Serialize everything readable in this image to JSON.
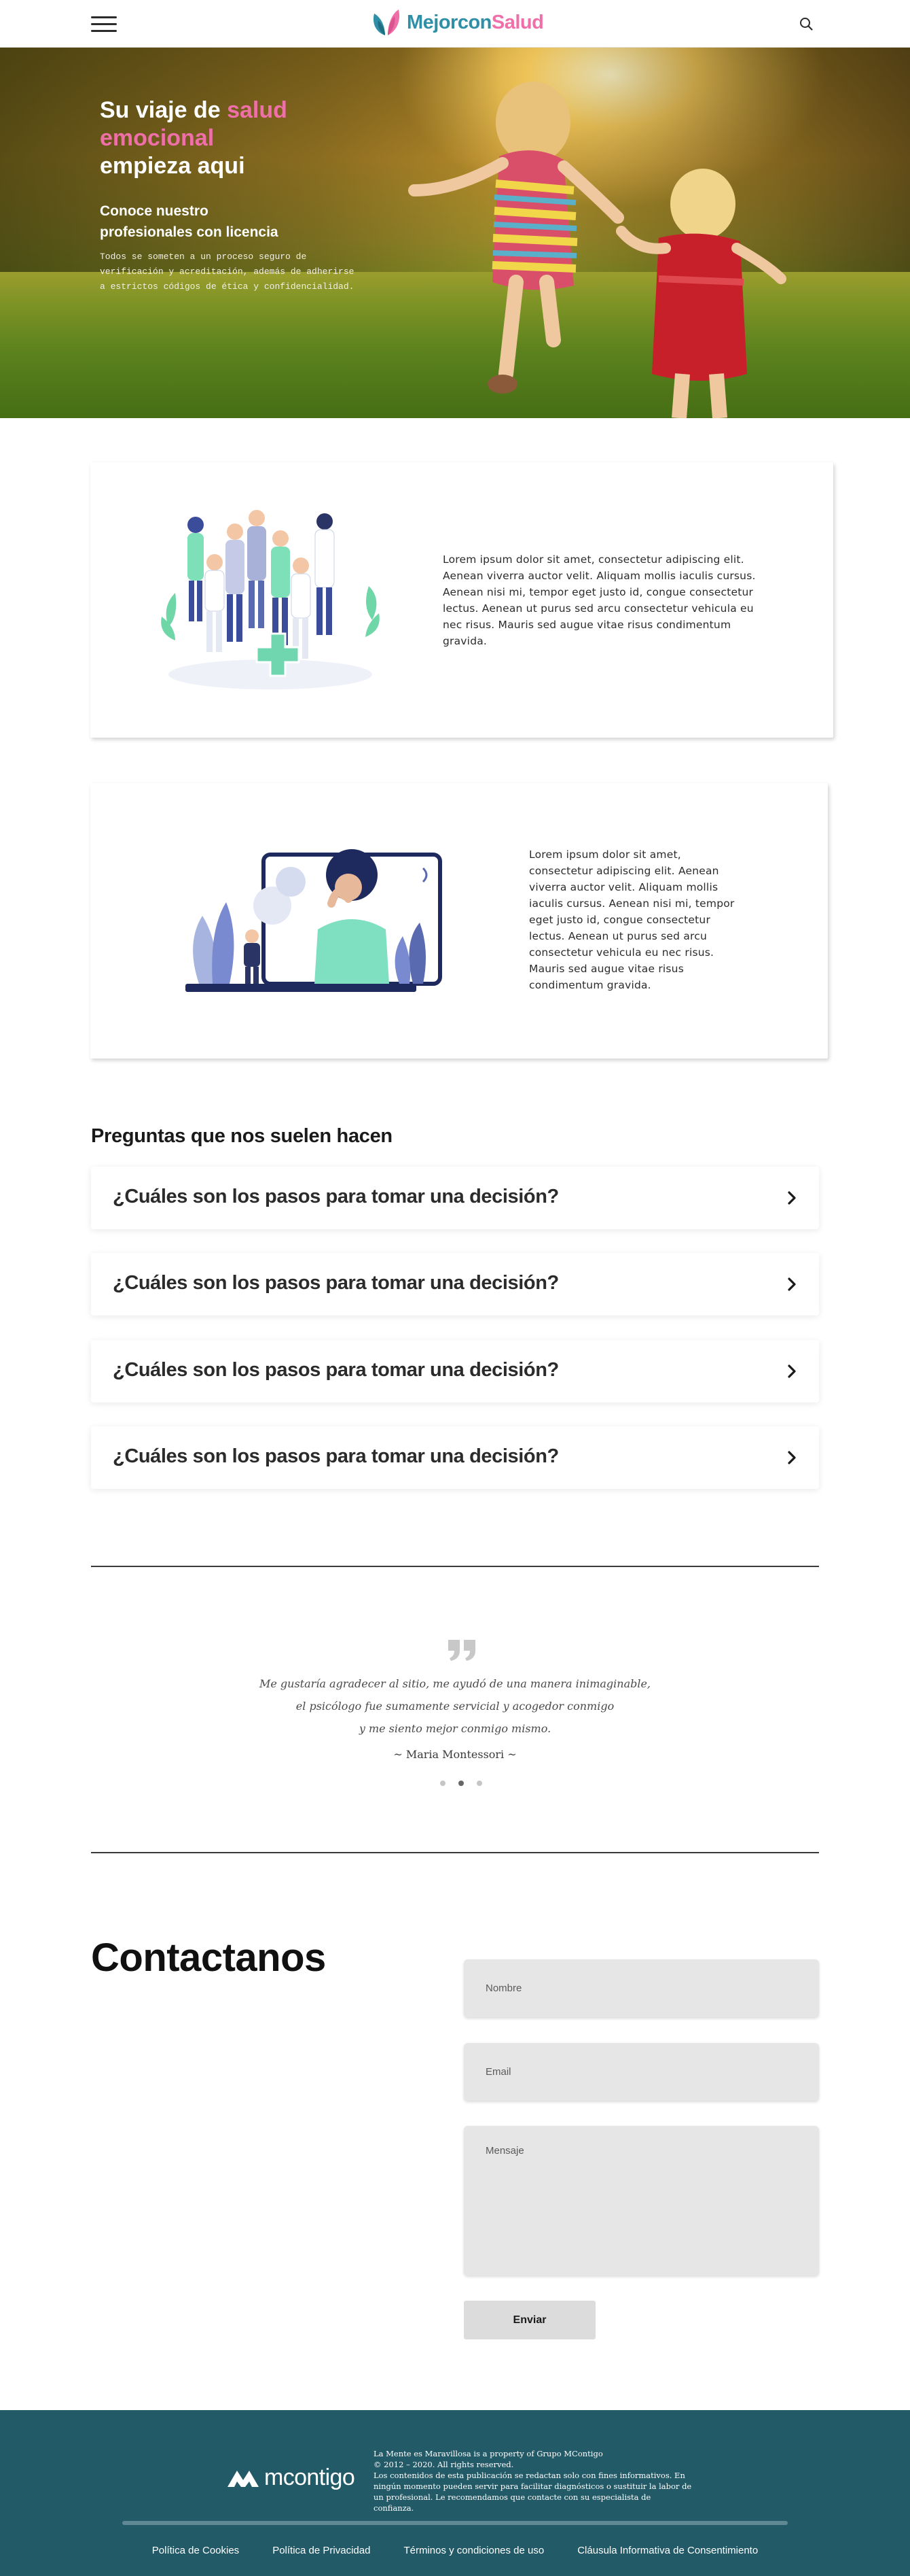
{
  "header": {
    "menu_icon": "hamburger-menu-icon",
    "logo_icon": "butterfly-icon",
    "logo_part1": "Mejor",
    "logo_part2": "con",
    "logo_part3": "Salud",
    "search_icon": "search-icon",
    "brand_colors": {
      "teal": "#2f8fa6",
      "pink": "#ef6fa8"
    }
  },
  "hero": {
    "title_prefix": "Su viaje de ",
    "title_highlight_1": "salud",
    "title_highlight_2": "emocional",
    "title_suffix": "empieza aqui",
    "subtitle_line1": "Conoce nuestro",
    "subtitle_line2": "profesionales con licencia",
    "description": "Todos se someten a un proceso seguro de verificación y acreditación, además de adherirse a estrictos códigos de ética y confidencialidad."
  },
  "features": [
    {
      "illustration": "medical-team-illustration",
      "text": "Lorem ipsum dolor sit amet, consectetur adipiscing elit. Aenean viverra auctor velit. Aliquam mollis iaculis cursus. Aenean nisi mi, tempor eget justo id, congue consectetur lectus. Aenean ut purus sed arcu consectetur vehicula eu nec risus.        Mauris sed augue vitae risus condimentum gravida."
    },
    {
      "illustration": "video-consultation-illustration",
      "text": "Lorem ipsum dolor sit amet, consectetur adipiscing elit. Aenean viverra auctor velit. Aliquam mollis iaculis cursus. Aenean nisi mi, tempor eget justo id, congue consectetur  lectus. Aenean ut purus sed arcu consectetur vehicula eu nec risus.        Mauris sed augue vitae risus condimentum gravida."
    }
  ],
  "faq": {
    "title": "Preguntas que nos suelen hacen",
    "items": [
      {
        "question": "¿Cuáles son los pasos para tomar una decisión?"
      },
      {
        "question": "¿Cuáles son los pasos para tomar una decisión?"
      },
      {
        "question": "¿Cuáles son los pasos para tomar una decisión?"
      },
      {
        "question": "¿Cuáles son los pasos para tomar una decisión?"
      }
    ]
  },
  "testimonial": {
    "quote_icon": "quote-icon",
    "line1": "Me gustaría agradecer al sitio, me ayudó de una manera inimaginable,",
    "line2": "el psicólogo fue sumamente servicial y acogedor conmigo",
    "line3": "y me siento mejor conmigo mismo.",
    "author": "~ Maria Montessori ~",
    "slide_count": 3,
    "active_slide": 2
  },
  "contact": {
    "title": "Contactanos",
    "name_placeholder": "Nombre",
    "email_placeholder": "Email",
    "message_placeholder": "Mensaje",
    "submit_label": "Enviar"
  },
  "footer": {
    "logo_text": "mcontigo",
    "logo_icon": "mcontigo-logo-icon",
    "info_line1": "La Mente es Maravillosa is a property of Grupo MContigo",
    "info_line2": "© 2012 – 2020. All rights reserved.",
    "info_line3": "Los contenidos de esta publicación se redactan solo con fines informativos. En ningún momento pueden servir para facilitar diagnósticos o sustituir la labor de un profesional. Le recomendamos que contacte con su especialista de confianza.",
    "links": [
      {
        "label": "Política de Cookies"
      },
      {
        "label": "Política de Privacidad"
      },
      {
        "label": "Términos y condiciones de uso"
      },
      {
        "label": "Cláusula Informativa de Consentimiento"
      }
    ],
    "background_color": "#235a67"
  }
}
